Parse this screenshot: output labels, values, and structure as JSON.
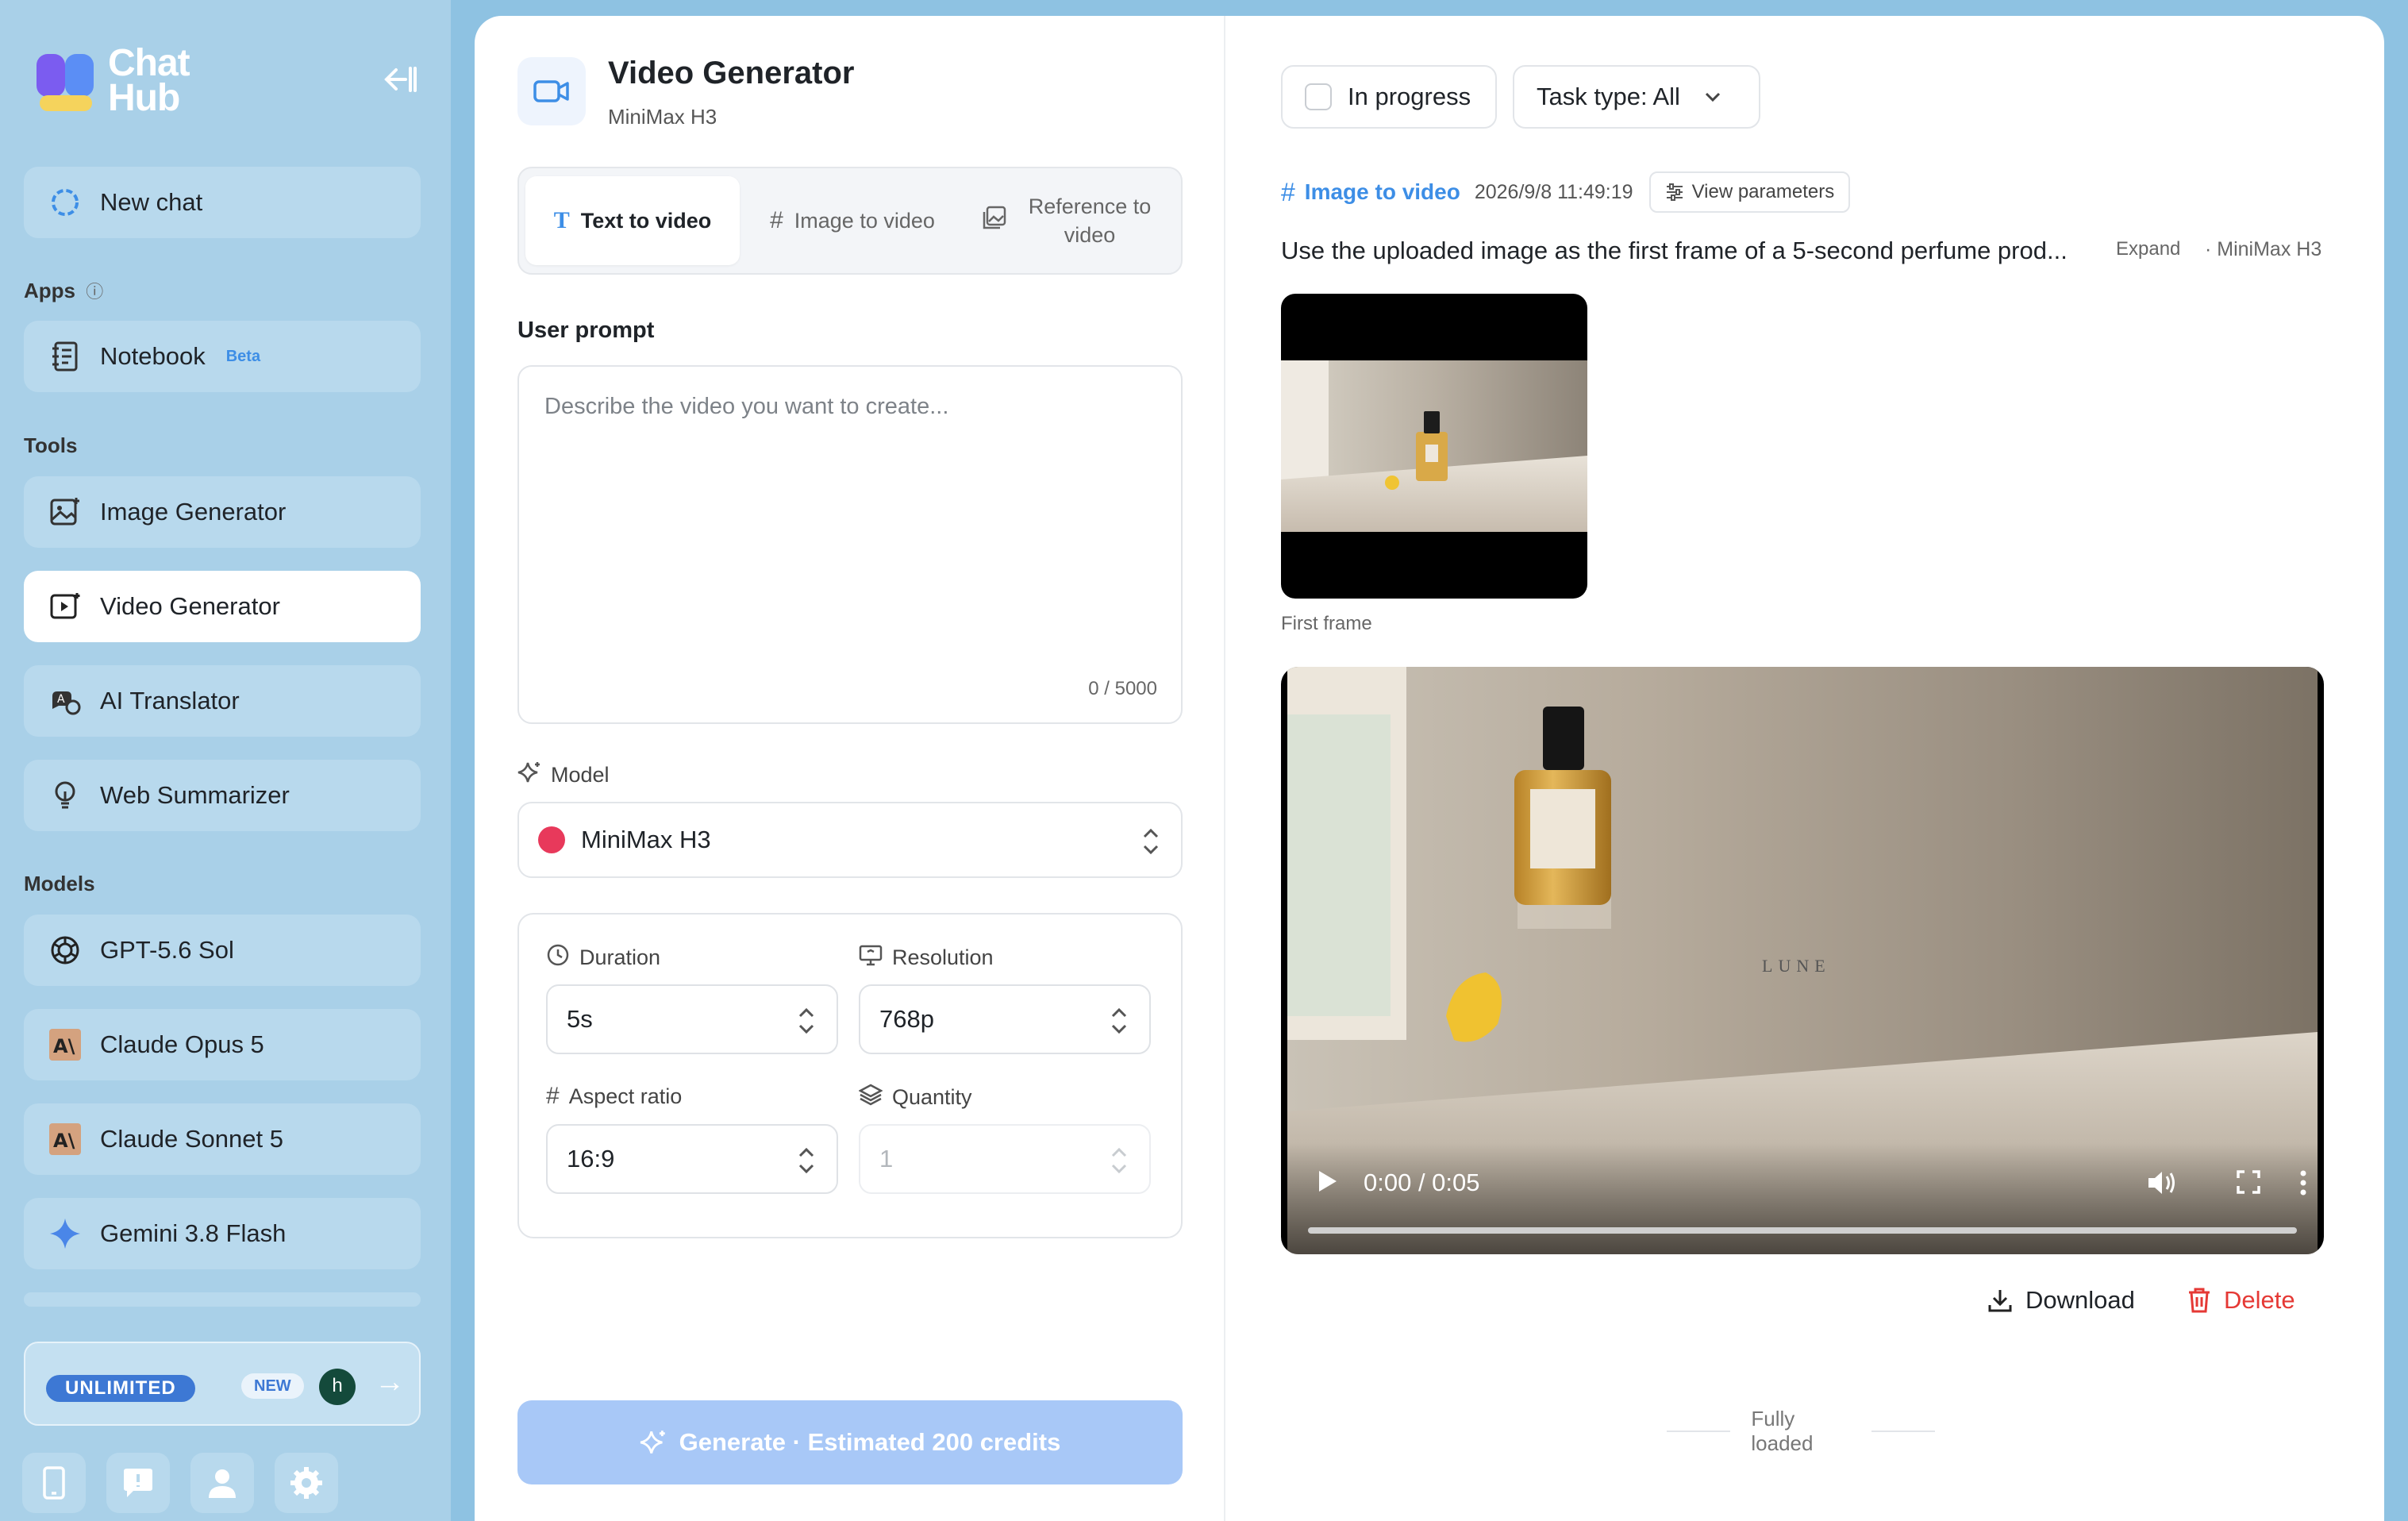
{
  "sidebar": {
    "logo_text_line1": "Chat",
    "logo_text_line2": "Hub",
    "new_chat": "New chat",
    "apps_label": "Apps",
    "notebook": "Notebook",
    "notebook_badge": "Beta",
    "tools_label": "Tools",
    "tools": [
      "Image Generator",
      "Video Generator",
      "AI Translator",
      "Web Summarizer"
    ],
    "active_tool": "Video Generator",
    "models_label": "Models",
    "models": [
      "GPT-5.6 Sol",
      "Claude Opus 5",
      "Claude Sonnet 5",
      "Gemini 3.8 Flash"
    ],
    "promo": {
      "plan": "UNLIMITED",
      "new_badge": "NEW",
      "avatar_letter": "h"
    },
    "bottom_icons": [
      "phone-icon",
      "feedback-icon",
      "user-icon",
      "settings-icon"
    ]
  },
  "generator": {
    "title": "Video Generator",
    "subtitle": "MiniMax H3",
    "tabs": [
      {
        "label": "Text to video",
        "icon": "text-icon",
        "active": true
      },
      {
        "label": "Image to video",
        "icon": "grid-icon",
        "active": false
      },
      {
        "label": "Reference to video",
        "icon": "reference-image-icon",
        "active": false
      }
    ],
    "prompt_label": "User prompt",
    "prompt_placeholder": "Describe the video you want to create...",
    "prompt_count": "0 / 5000",
    "model_label": "Model",
    "model_value": "MiniMax H3",
    "duration_label": "Duration",
    "duration_value": "5s",
    "resolution_label": "Resolution",
    "resolution_value": "768p",
    "aspect_label": "Aspect ratio",
    "aspect_value": "16:9",
    "quantity_label": "Quantity",
    "quantity_value": "1",
    "generate_button": "Generate · Estimated 200 credits"
  },
  "results": {
    "filter_in_progress": "In progress",
    "filter_task_type": "Task type: All",
    "task": {
      "type": "Image to video",
      "timestamp": "2026/9/8 11:49:19",
      "view_params": "View parameters",
      "prompt": "Use the uploaded image as the first frame of a 5-second perfume prod...",
      "expand": "Expand",
      "model": "· MiniMax H3",
      "first_frame_label": "First frame",
      "bottle_label": "LUNE",
      "video_time": "0:00 / 0:05",
      "download": "Download",
      "delete": "Delete"
    },
    "footer": "Fully loaded"
  },
  "colors": {
    "accent": "#3d8ee6",
    "danger": "#e53935",
    "sidebar_bg": "#a9d0e8",
    "button_disabled": "#a8c8f7"
  }
}
